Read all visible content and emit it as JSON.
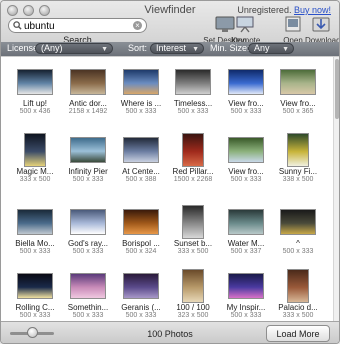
{
  "window": {
    "title": "Viewfinder",
    "registration_text": "Unregistered.",
    "buy_link": "Buy now!"
  },
  "search": {
    "value": "ubuntu",
    "caption": "Search",
    "icon": "search-icon",
    "clear_icon": "clear-icon"
  },
  "toolbar": {
    "set_desktop": "Set Desktop",
    "keynote": "Keynote",
    "open": "Open",
    "download": "Download"
  },
  "filters": {
    "license_label": "License:",
    "license_value": "(Any)",
    "sort_label": "Sort:",
    "sort_value": "Interest",
    "min_size_label": "Min. Size:",
    "min_size_value": "Any"
  },
  "photos": [
    {
      "caption": "Lift up!",
      "dims": "500 x 436",
      "colors": [
        "#162231",
        "#5f82a4",
        "#e6e6e6"
      ],
      "shape": "land"
    },
    {
      "caption": "Antic dor...",
      "dims": "2158 x 1492",
      "colors": [
        "#4b3424",
        "#8a6b4a",
        "#c7b79a"
      ],
      "shape": "land"
    },
    {
      "caption": "Where is ...",
      "dims": "500 x 333",
      "colors": [
        "#1e3a6a",
        "#6a8cc0",
        "#d8a76a"
      ],
      "shape": "land"
    },
    {
      "caption": "Timeless...",
      "dims": "500 x 333",
      "colors": [
        "#2b2b2b",
        "#7e7e7e",
        "#cfcfcf"
      ],
      "shape": "land"
    },
    {
      "caption": "View fro...",
      "dims": "500 x 333",
      "colors": [
        "#0f2a6a",
        "#3a6ad0",
        "#e0e8f8"
      ],
      "shape": "land"
    },
    {
      "caption": "View fro...",
      "dims": "500 x 365",
      "colors": [
        "#4d6c3a",
        "#a8b48a",
        "#d8c8a8"
      ],
      "shape": "land"
    },
    {
      "caption": "Magic M...",
      "dims": "333 x 500",
      "colors": [
        "#0e1420",
        "#3c4c68",
        "#e6d27a"
      ],
      "shape": "port"
    },
    {
      "caption": "Infinity Pier",
      "dims": "500 x 333",
      "colors": [
        "#3e6c8c",
        "#9cc0d8",
        "#3a4a3a"
      ],
      "shape": "land"
    },
    {
      "caption": "At Cente...",
      "dims": "500 x 388",
      "colors": [
        "#222a3a",
        "#6a7ca0",
        "#c8d0e0"
      ],
      "shape": "land"
    },
    {
      "caption": "Red Pillar...",
      "dims": "1500 x 2268",
      "colors": [
        "#3a1410",
        "#a02a1c",
        "#d86a48"
      ],
      "shape": "port"
    },
    {
      "caption": "View fro...",
      "dims": "500 x 333",
      "colors": [
        "#3a5a2a",
        "#8ab07a",
        "#c8d8e8"
      ],
      "shape": "land"
    },
    {
      "caption": "Sunny Fi...",
      "dims": "338 x 500",
      "colors": [
        "#2e4a2a",
        "#c8b43a",
        "#f0f0e0"
      ],
      "shape": "port"
    },
    {
      "caption": "Biella Mo...",
      "dims": "500 x 333",
      "colors": [
        "#1a2a3a",
        "#4a6a8a",
        "#c0c8d0"
      ],
      "shape": "land"
    },
    {
      "caption": "God's ray...",
      "dims": "500 x 333",
      "colors": [
        "#4a5a7a",
        "#a8b8d8",
        "#ffffff"
      ],
      "shape": "land"
    },
    {
      "caption": "Borispol ...",
      "dims": "500 x 324",
      "colors": [
        "#3a1a0a",
        "#a0581a",
        "#e89848"
      ],
      "shape": "land"
    },
    {
      "caption": "Sunset b...",
      "dims": "333 x 500",
      "colors": [
        "#2a2a2a",
        "#8a8a8a",
        "#d8d8d8"
      ],
      "shape": "port"
    },
    {
      "caption": "Water M...",
      "dims": "500 x 337",
      "colors": [
        "#2a3a3a",
        "#6a8a8a",
        "#b8c8c8"
      ],
      "shape": "land"
    },
    {
      "caption": "^",
      "dims": "500 x 333",
      "colors": [
        "#1a1a1a",
        "#4a4a3a",
        "#c8a848"
      ],
      "shape": "land"
    },
    {
      "caption": "Rolling C...",
      "dims": "500 x 333",
      "colors": [
        "#0a0a14",
        "#1a2a4a",
        "#f0e0a0"
      ],
      "shape": "land"
    },
    {
      "caption": "Somethin...",
      "dims": "500 x 333",
      "colors": [
        "#5a3a7a",
        "#c88ab8",
        "#f0c8e0"
      ],
      "shape": "land"
    },
    {
      "caption": "Geranis (...",
      "dims": "500 x 333",
      "colors": [
        "#2a1a3a",
        "#5a4a8a",
        "#a898c8"
      ],
      "shape": "land"
    },
    {
      "caption": "100 / 100",
      "dims": "323 x 500",
      "colors": [
        "#6a4a2a",
        "#b89a6a",
        "#e8d8b8"
      ],
      "shape": "port"
    },
    {
      "caption": "My Inspir...",
      "dims": "500 x 333",
      "colors": [
        "#1a1a4a",
        "#4a3aa0",
        "#d870c8"
      ],
      "shape": "land"
    },
    {
      "caption": "Palacio d...",
      "dims": "333 x 500",
      "colors": [
        "#4a2a1a",
        "#9a5a3a",
        "#d8b898"
      ],
      "shape": "port"
    }
  ],
  "footer": {
    "photo_count": "100 Photos",
    "load_more": "Load More"
  }
}
